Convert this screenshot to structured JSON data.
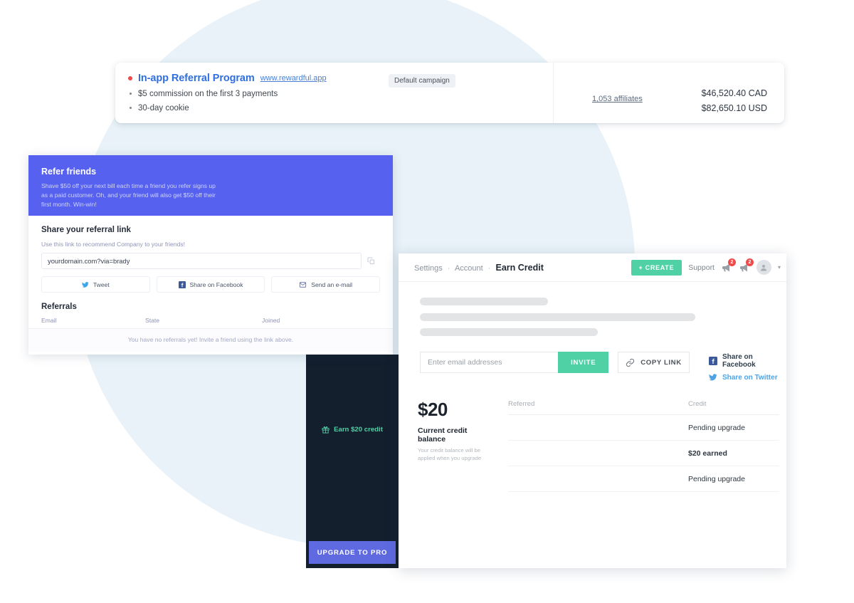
{
  "campaign": {
    "title": "In-app Referral Program",
    "url": "www.rewardful.app",
    "bullets": [
      "$5 commission on the first 3 payments",
      "30-day cookie"
    ],
    "badge": "Default campaign",
    "affiliates": "1,053 affiliates",
    "amount_cad": "$46,520.40 CAD",
    "amount_usd": "$82,650.10 USD",
    "dot_color": "#ef4b4b",
    "title_color": "#2f6fe0"
  },
  "referral_widget": {
    "hero_title": "Refer friends",
    "hero_copy": "Shave $50 off your next bill each time a friend you refer signs up as a paid customer. Oh, and your friend will also get $50 off their first month. Win-win!",
    "hero_bg": "#5661f0",
    "share_title": "Share your referral link",
    "share_sub": "Use this link to recommend Company to your friends!",
    "link_value": "yourdomain.com?via=brady",
    "copy_icon": "copy-icon",
    "buttons": [
      {
        "label": "Tweet",
        "icon": "twitter-icon"
      },
      {
        "label": "Share on Facebook",
        "icon": "facebook-icon"
      },
      {
        "label": "Send an e-mail",
        "icon": "envelope-icon"
      }
    ],
    "referrals_title": "Referrals",
    "columns": [
      "Email",
      "State",
      "Joined"
    ],
    "empty_text": "You have no referrals yet! Invite a friend using the link above."
  },
  "dark_panel": {
    "earn_label": "Earn $20 credit",
    "earn_icon": "gift-icon",
    "earn_color": "#4fd1a5",
    "upgrade_label": "UPGRADE TO PRO",
    "upgrade_bg": "#5f6ae0",
    "bg": "#131f2d"
  },
  "app": {
    "breadcrumb": {
      "level1": "Settings",
      "level2": "Account",
      "current": "Earn Credit"
    },
    "create_label": "+ CREATE",
    "create_bg": "#4fd1a5",
    "support_label": "Support",
    "notifications": [
      {
        "icon": "megaphone-icon",
        "count": "2"
      },
      {
        "icon": "bell-icon",
        "count": "2"
      }
    ],
    "avatar": "user-avatar",
    "chevron": "chevron-down-icon",
    "email_placeholder": "Enter email addresses",
    "invite_label": "INVITE",
    "copy_link_label": "COPY LINK",
    "copy_link_icon": "link-icon",
    "social": [
      {
        "label": "Share on Facebook",
        "icon": "facebook-icon",
        "color": "#33404e"
      },
      {
        "label": "Share on Twitter",
        "icon": "twitter-icon",
        "color": "#4fa3e3"
      }
    ],
    "credit": {
      "amount": "$20",
      "balance_label": "Current credit balance",
      "balance_sub": "Your credit balance will be applied when you upgrade",
      "columns": [
        "Referred",
        "Credit"
      ],
      "rows": [
        {
          "referred": "",
          "credit": "Pending upgrade",
          "bold": false
        },
        {
          "referred": "",
          "credit": "$20 earned",
          "bold": true
        },
        {
          "referred": "",
          "credit": "Pending upgrade",
          "bold": false
        }
      ]
    }
  },
  "theme": {
    "background_circle": "#e8f2f8"
  }
}
